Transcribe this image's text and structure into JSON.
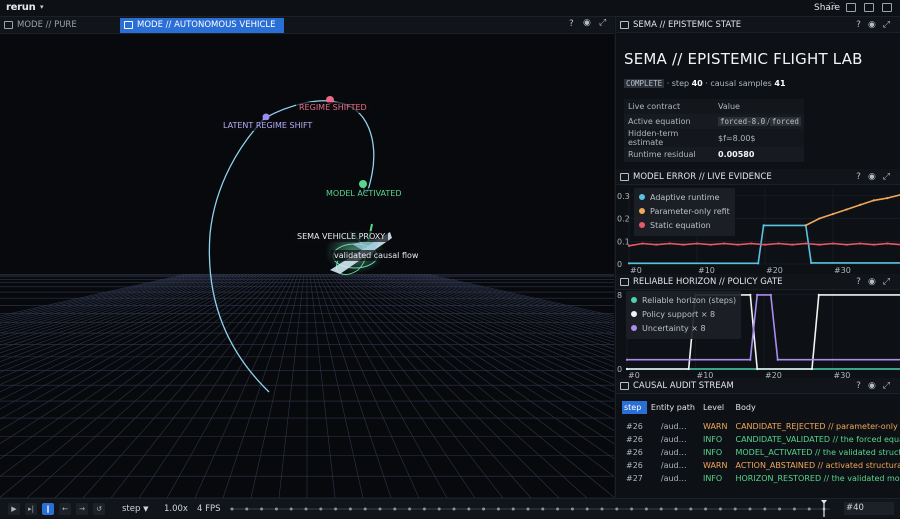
{
  "app": {
    "logo": "rerun",
    "share_label": "Share"
  },
  "tabs": [
    {
      "label": "MODE // PURE DYNAMICS",
      "active": false
    },
    {
      "label": "MODE // AUTONOMOUS VEHICLE",
      "active": true
    }
  ],
  "viewport": {
    "tool_help": "?",
    "labels": {
      "regime_shifted": "REGIME SHIFTED",
      "latent_regime_shift": "LATENT REGIME SHIFT",
      "model_activated": "MODEL ACTIVATED",
      "vehicle_proxy": "SEMA VEHICLE PROXY",
      "causal_flow": "validated causal flow"
    },
    "colors": {
      "trajectory": "#8fd3ee",
      "regime": "#e86d84",
      "latent": "#9d8cf0",
      "model": "#58d68d",
      "grid": "#39405c"
    }
  },
  "sema_panel": {
    "header": "SEMA // EPISTEMIC STATE",
    "title": "SEMA // EPISTEMIC FLIGHT LAB",
    "status_badge": "COMPLETE",
    "step_label": "· step",
    "step_value": "40",
    "samples_label": "· causal samples",
    "samples_value": "41",
    "table": {
      "col_key": "Live contract",
      "col_value": "Value",
      "rows": [
        {
          "key": "Active equation",
          "value_a": "forced-8.0",
          "sep": "/",
          "value_b": "forced"
        },
        {
          "key": "Hidden-term estimate",
          "value": "$f=8.00$"
        },
        {
          "key": "Runtime residual",
          "value": "0.00580"
        }
      ]
    }
  },
  "model_error_panel": {
    "header": "MODEL ERROR // LIVE EVIDENCE",
    "legend": [
      "Adaptive runtime",
      "Parameter-only refit",
      "Static equation"
    ]
  },
  "horizon_panel": {
    "header": "RELIABLE HORIZON // POLICY GATE",
    "legend": [
      "Reliable horizon (steps)",
      "Policy support × 8",
      "Uncertainty × 8"
    ]
  },
  "chart_data": [
    {
      "type": "line",
      "title": "MODEL ERROR // LIVE EVIDENCE",
      "x_ticks": [
        "#0",
        "#10",
        "#20",
        "#30"
      ],
      "y_ticks": [
        "0",
        "0.1",
        "0.2",
        "0.3"
      ],
      "ylim": [
        0,
        0.33
      ],
      "xlim": [
        0,
        40
      ],
      "series": [
        {
          "name": "Adaptive runtime",
          "color": "#59c3e6",
          "points": [
            [
              0,
              0.003
            ],
            [
              19,
              0.003
            ],
            [
              19.8,
              0.17
            ],
            [
              26,
              0.17
            ],
            [
              26.8,
              0.005
            ],
            [
              40,
              0.005
            ]
          ]
        },
        {
          "name": "Parameter-only refit",
          "color": "#f0a85a",
          "points": [
            [
              26,
              0.17
            ],
            [
              28,
              0.2
            ],
            [
              30,
              0.22
            ],
            [
              32,
              0.24
            ],
            [
              34,
              0.26
            ],
            [
              36,
              0.28
            ],
            [
              38,
              0.29
            ],
            [
              40,
              0.305
            ]
          ]
        },
        {
          "name": "Static equation",
          "color": "#e8586a",
          "points": [
            [
              0,
              0.08
            ],
            [
              2,
              0.09
            ],
            [
              4,
              0.085
            ],
            [
              6,
              0.09
            ],
            [
              8,
              0.085
            ],
            [
              10,
              0.09
            ],
            [
              12,
              0.085
            ],
            [
              14,
              0.09
            ],
            [
              16,
              0.085
            ],
            [
              18,
              0.09
            ],
            [
              20,
              0.085
            ],
            [
              22,
              0.09
            ],
            [
              24,
              0.085
            ],
            [
              26,
              0.09
            ],
            [
              28,
              0.085
            ],
            [
              30,
              0.09
            ],
            [
              32,
              0.085
            ],
            [
              34,
              0.09
            ],
            [
              36,
              0.085
            ],
            [
              38,
              0.09
            ],
            [
              40,
              0.085
            ]
          ]
        }
      ]
    },
    {
      "type": "line",
      "title": "RELIABLE HORIZON // POLICY GATE",
      "x_ticks": [
        "#0",
        "#10",
        "#20",
        "#30"
      ],
      "y_ticks": [
        "0",
        "8"
      ],
      "ylim": [
        0,
        8.2
      ],
      "xlim": [
        0,
        40
      ],
      "series": [
        {
          "name": "Reliable horizon (steps)",
          "color": "#4fd1b0",
          "points": [
            [
              0,
              0
            ],
            [
              40,
              0
            ]
          ]
        },
        {
          "name": "Policy support × 8",
          "color": "#f2f2f2",
          "points": [
            [
              0,
              0
            ],
            [
              9,
              0
            ],
            [
              10,
              8
            ],
            [
              18,
              8
            ],
            [
              19,
              0
            ],
            [
              27,
              0
            ],
            [
              28,
              8
            ],
            [
              40,
              8
            ]
          ]
        },
        {
          "name": "Uncertainty × 8",
          "color": "#a98ef0",
          "points": [
            [
              0,
              1
            ],
            [
              18,
              1
            ],
            [
              19,
              8
            ],
            [
              21,
              8
            ],
            [
              22,
              1
            ],
            [
              40,
              1
            ]
          ]
        }
      ]
    }
  ],
  "audit_panel": {
    "header": "CAUSAL AUDIT STREAM",
    "columns": {
      "step": "step",
      "entity": "Entity path",
      "level": "Level",
      "body": "Body"
    },
    "rows": [
      {
        "step": "#26",
        "entity": "/aud…",
        "level": "WARN",
        "body": "CANDIDATE_REJECTED // parameter-only refit"
      },
      {
        "step": "#26",
        "entity": "/aud…",
        "level": "INFO",
        "body": "CANDIDATE_VALIDATED // the forced equation"
      },
      {
        "step": "#26",
        "entity": "/aud…",
        "level": "INFO",
        "body": "MODEL_ACTIVATED // the validated structural"
      },
      {
        "step": "#26",
        "entity": "/aud…",
        "level": "WARN",
        "body": "ACTION_ABSTAINED // activated structural m"
      },
      {
        "step": "#27",
        "entity": "/aud…",
        "level": "INFO",
        "body": "HORIZON_RESTORED // the validated model"
      }
    ]
  },
  "timeline": {
    "timeline_name": "step",
    "speed": "1.00x",
    "fps": "4 FPS",
    "current": "#40",
    "progress": 1.0
  }
}
